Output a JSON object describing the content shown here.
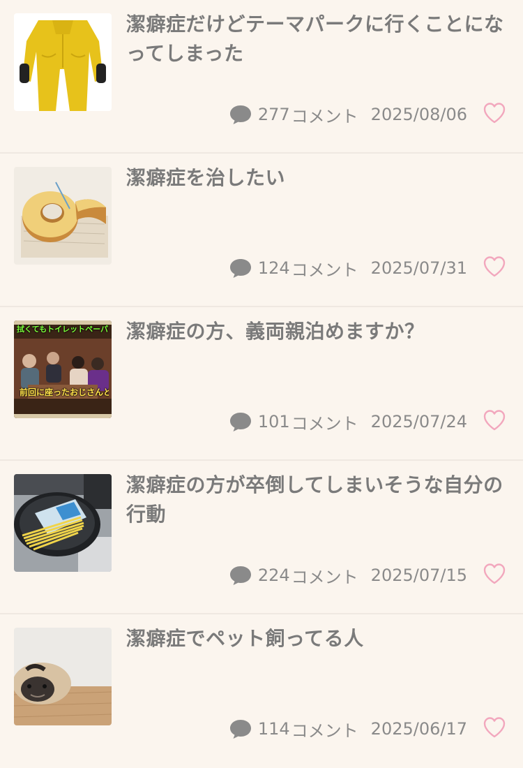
{
  "colors": {
    "background": "#fbf5ee",
    "title": "#7a7a7a",
    "meta": "#8a8a8a",
    "heart_outline": "#f2a7bd",
    "divider": "#efe8e1"
  },
  "items": [
    {
      "title": "潔癖症だけどテーマパークに行くことになってしまった",
      "comment_count": "277",
      "comment_label": "コメント",
      "date": "2025/08/06",
      "thumbnail": "yellow-hazmat-suit-image"
    },
    {
      "title": "潔癖症を治したい",
      "comment_count": "124",
      "comment_label": "コメント",
      "date": "2025/07/31",
      "thumbnail": "baumkuchen-image"
    },
    {
      "title": "潔癖症の方、義両親泊めますか？",
      "comment_count": "101",
      "comment_label": "コメント",
      "date": "2025/07/24",
      "thumbnail": "tv-show-screenshot-image",
      "thumb_caption_top": "拭くてもトイレットペーパーを",
      "thumb_caption_bottom": "前回に座ったおじさんと"
    },
    {
      "title": "潔癖症の方が卒倒してしまいそうな自分の行動",
      "comment_count": "224",
      "comment_label": "コメント",
      "date": "2025/07/15",
      "thumbnail": "pasta-in-frying-pan-image"
    },
    {
      "title": "潔癖症でペット飼ってる人",
      "comment_count": "114",
      "comment_label": "コメント",
      "date": "2025/06/17",
      "thumbnail": "sleeping-pug-image"
    }
  ]
}
